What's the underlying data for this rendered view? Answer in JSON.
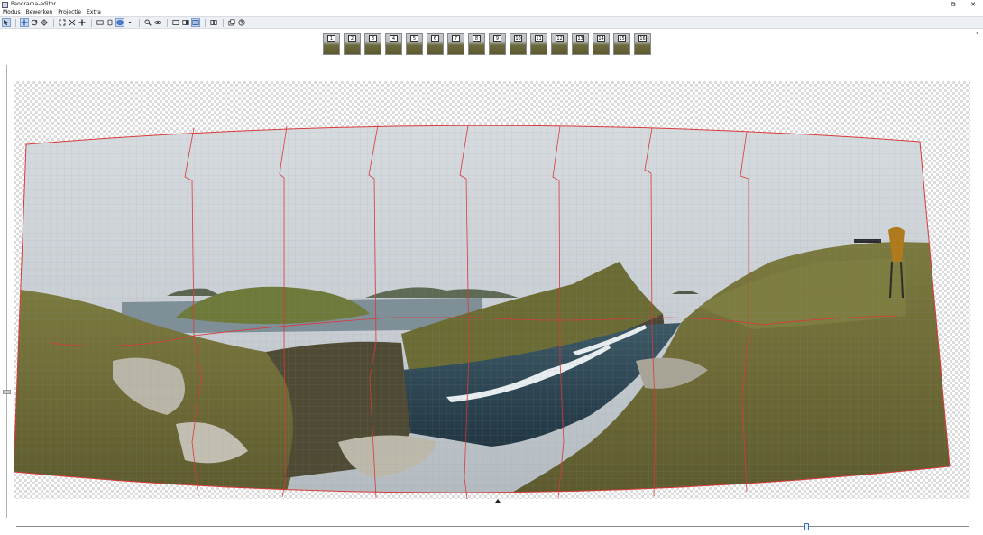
{
  "window": {
    "title": "Panorama-editor",
    "controls": [
      "—",
      "⧉",
      "✕"
    ]
  },
  "menu": {
    "items": [
      "Modus",
      "Bewerken",
      "Projectie",
      "Extra"
    ]
  },
  "toolbar": {
    "groups": [
      [
        "select-tool",
        "move-tool",
        "rotate-tool",
        "crop-tool"
      ],
      [
        "fit-icon",
        "shrink-icon",
        "center-icon"
      ],
      [
        "rectilinear-projection",
        "cylindrical-projection",
        "spherical-projection",
        "dropdown-arrow"
      ],
      [
        "zoom-icon",
        "preview-eye-icon"
      ],
      [
        "single-view",
        "split-view",
        "grid-overlay"
      ],
      [
        "compare-icon"
      ],
      [
        "layers-icon",
        "help-icon"
      ]
    ]
  },
  "thumbnails": [
    "1",
    "2",
    "3",
    "4",
    "5",
    "6",
    "7",
    "8",
    "9",
    "10",
    "11",
    "12",
    "13",
    "14",
    "15",
    "16"
  ],
  "colors": {
    "seam": "#d83a3a",
    "selection_highlight": "#c7d7f0",
    "slider_accent": "#2f6fc4"
  },
  "slider": {
    "position": 0.83
  }
}
